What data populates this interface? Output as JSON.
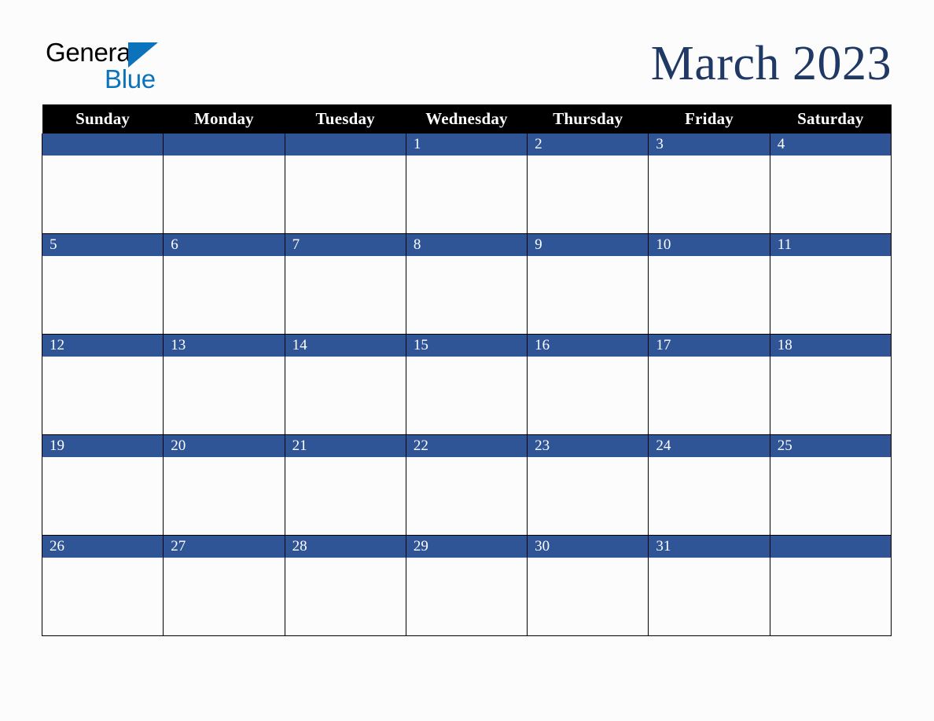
{
  "brand": {
    "line1": "General",
    "line2": "Blue",
    "triangle_icon": "triangle-icon",
    "line1_color": "#000000",
    "line2_color": "#0b73bb",
    "triangle_color": "#0b73bb"
  },
  "header": {
    "title": "March 2023",
    "title_color": "#1f3864"
  },
  "calendar": {
    "month": "March",
    "year": "2023",
    "header_bg": "#000000",
    "header_fg": "#ffffff",
    "date_band_bg": "#2f5596",
    "date_band_fg": "#ffffff",
    "grid_color": "#000000",
    "cell_bg": "#fcfcfc",
    "weekday_headers": [
      "Sunday",
      "Monday",
      "Tuesday",
      "Wednesday",
      "Thursday",
      "Friday",
      "Saturday"
    ],
    "weeks": [
      [
        "",
        "",
        "",
        "1",
        "2",
        "3",
        "4"
      ],
      [
        "5",
        "6",
        "7",
        "8",
        "9",
        "10",
        "11"
      ],
      [
        "12",
        "13",
        "14",
        "15",
        "16",
        "17",
        "18"
      ],
      [
        "19",
        "20",
        "21",
        "22",
        "23",
        "24",
        "25"
      ],
      [
        "26",
        "27",
        "28",
        "29",
        "30",
        "31",
        ""
      ]
    ]
  }
}
